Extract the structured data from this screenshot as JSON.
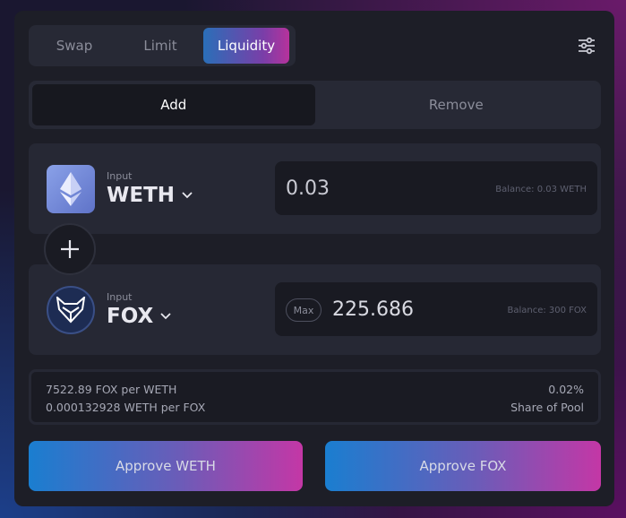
{
  "tabs": [
    {
      "label": "Swap",
      "active": false
    },
    {
      "label": "Limit",
      "active": false
    },
    {
      "label": "Liquidity",
      "active": true
    }
  ],
  "mode": {
    "add_label": "Add",
    "remove_label": "Remove",
    "active": "Add"
  },
  "token1": {
    "input_label": "Input",
    "symbol": "WETH",
    "amount": "0.03",
    "balance": "Balance: 0.03 WETH",
    "icon": "ethereum-icon"
  },
  "token2": {
    "input_label": "Input",
    "symbol": "FOX",
    "amount": "225.686",
    "balance": "Balance: 300 FOX",
    "max_label": "Max",
    "icon": "fox-icon"
  },
  "pool_info": {
    "rate1": "7522.89 FOX per WETH",
    "rate2": "0.000132928 WETH per FOX",
    "share": "0.02%",
    "share_label": "Share of Pool"
  },
  "buttons": {
    "approve_weth": "Approve WETH",
    "approve_fox": "Approve FOX"
  },
  "colors": {
    "panel": "#1d1e27",
    "card": "#262834",
    "accent_start": "#1a7ed0",
    "accent_end": "#c437a6"
  }
}
